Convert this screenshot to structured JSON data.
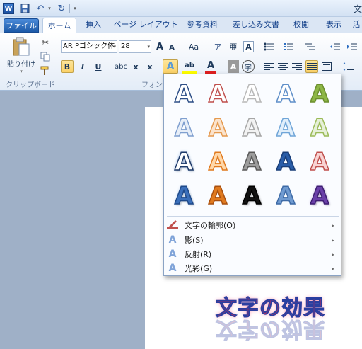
{
  "titlebar": {
    "app_icon_letter": "W",
    "undo_icon": "↶",
    "redo_icon": "↻",
    "dropdown_glyph": "▾",
    "title_fragment": "文"
  },
  "tabs": [
    "ファイル",
    "ホーム",
    "挿入",
    "ページ レイアウト",
    "参考資料",
    "差し込み文書",
    "校閲",
    "表示",
    "活"
  ],
  "ribbon": {
    "paste_label": "貼り付け",
    "clipboard_label": "クリップボード",
    "font_group_label": "フォント",
    "font_name": "AR Pゴシック体",
    "font_size": "28",
    "grow_font": "A",
    "shrink_font": "A",
    "change_case": "Aa",
    "clear_fmt": "ア",
    "ruby": "亜",
    "char_border": "A",
    "bold": "B",
    "italic": "I",
    "underline": "U",
    "strike": "abc",
    "subscript": "x",
    "superscript": "x",
    "text_effects": "A",
    "highlight": "ab",
    "font_color": "A",
    "char_shading": "A",
    "enclose": "字",
    "cut_icon": "✂"
  },
  "gallery": {
    "glyph": "A",
    "items": [
      {
        "fill": "#ffffff",
        "stroke": "#2e4f87",
        "glow": ""
      },
      {
        "fill": "#ffffff",
        "stroke": "#c0504d",
        "glow": ""
      },
      {
        "fill": "#ffffff",
        "stroke": "#b8b8b8",
        "glow": ""
      },
      {
        "fill": "#ffffff",
        "stroke": "#5f8fc9",
        "glow": ""
      },
      {
        "fill": "#8db646",
        "stroke": "#6b8f2e",
        "glow": ""
      },
      {
        "fill": "#e7eef8",
        "stroke": "#7f9fcf",
        "glow": ""
      },
      {
        "fill": "#fbe3cc",
        "stroke": "#e59a4f",
        "glow": ""
      },
      {
        "fill": "#f2f2f2",
        "stroke": "#a6a6a6",
        "glow": ""
      },
      {
        "fill": "#e0eefa",
        "stroke": "#6fa5d8",
        "glow": ""
      },
      {
        "fill": "#e6f0d8",
        "stroke": "#9bbb59",
        "glow": ""
      },
      {
        "fill": "#ffffff",
        "stroke": "#1f3b6a",
        "glow": "#7fa3d8"
      },
      {
        "fill": "#ffd7a8",
        "stroke": "#e07a1f",
        "glow": ""
      },
      {
        "fill": "#9c9c9c",
        "stroke": "#595959",
        "glow": ""
      },
      {
        "fill": "#2a5da8",
        "stroke": "#1a3e78",
        "glow": ""
      },
      {
        "fill": "#f8d3d3",
        "stroke": "#c0504d",
        "glow": ""
      },
      {
        "fill": "#3a6fba",
        "stroke": "#1f4a8a",
        "glow": "#bcd3ef"
      },
      {
        "fill": "#e07a1f",
        "stroke": "#a85010",
        "glow": ""
      },
      {
        "fill": "#111111",
        "stroke": "#000000",
        "glow": "#cfcfcf"
      },
      {
        "fill": "#6f9ad0",
        "stroke": "#3d6aa6",
        "glow": ""
      },
      {
        "fill": "#6a3fa8",
        "stroke": "#3e1e72",
        "glow": "#c7b3e6"
      }
    ],
    "menu": [
      {
        "label": "文字の輪郭(O)",
        "icon": "A",
        "icon_color": "#c0504d"
      },
      {
        "label": "影(S)",
        "icon": "A",
        "icon_color": "#7fa3d8"
      },
      {
        "label": "反射(R)",
        "icon": "A",
        "icon_color": "#7fa3d8"
      },
      {
        "label": "光彩(G)",
        "icon": "A",
        "icon_color": "#7fa3d8"
      }
    ],
    "submenu_arrow": "▸"
  },
  "document": {
    "effect_text": "文字の効果"
  }
}
